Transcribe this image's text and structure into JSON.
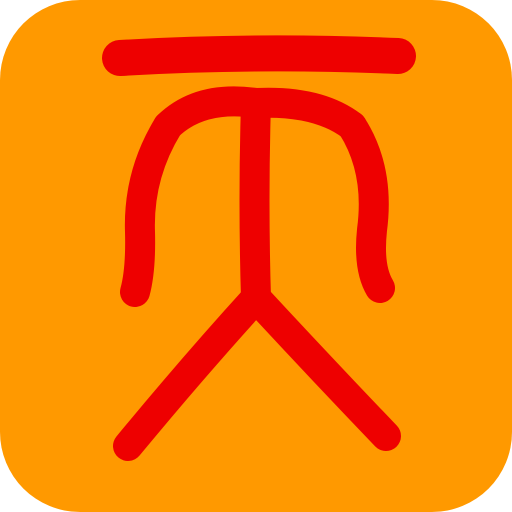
{
  "app_icon": {
    "glyph_name": "seal-script-tian-glyph",
    "colors": {
      "tile_background": "#FF9900",
      "glyph_stroke": "#EE0000"
    }
  }
}
